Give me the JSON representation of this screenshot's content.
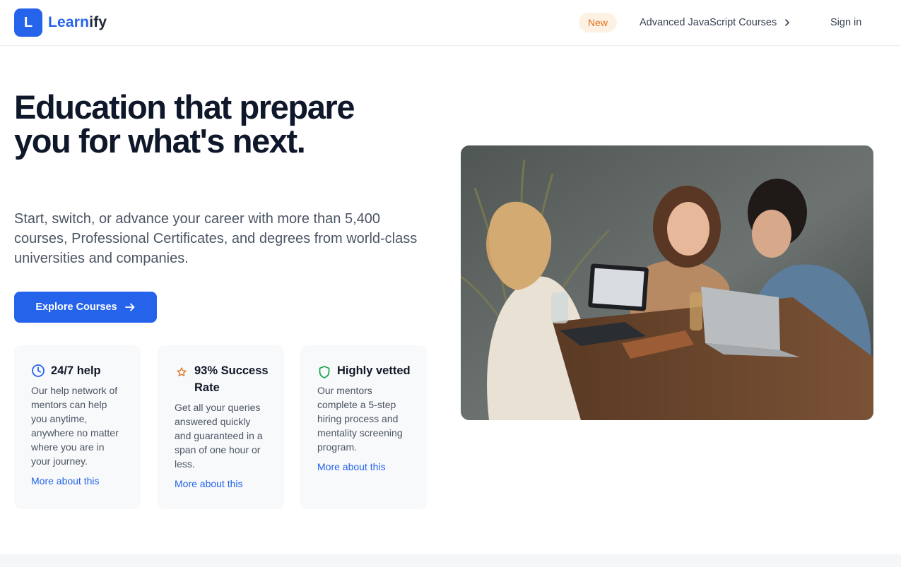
{
  "brand": {
    "logo_letter": "L",
    "name_part1": "Learn",
    "name_part2": "ify",
    "accent_color": "#2563eb"
  },
  "nav": {
    "badge": "New",
    "course_link": "Advanced JavaScript Courses",
    "sign_in": "Sign in"
  },
  "hero": {
    "title": "Education that prepare you for what's next.",
    "subtitle": "Start, switch, or advance your career with more than 5,400 courses, Professional Certificates, and degrees from world-class universities and companies.",
    "cta_label": "Explore Courses"
  },
  "features": [
    {
      "icon": "clock-icon",
      "icon_color": "#2563eb",
      "title": "24/7 help",
      "description": "Our help network of mentors can help you anytime, anywhere no matter where you are in your journey.",
      "link": "More about this"
    },
    {
      "icon": "star-icon",
      "icon_color": "#e0701a",
      "title": "93% Success Rate",
      "description": "Get all your queries answered quickly and guaranteed in a span of one hour or less.",
      "link": "More about this"
    },
    {
      "icon": "shield-icon",
      "icon_color": "#16a34a",
      "title": "Highly vetted",
      "description": "Our mentors complete a 5-step hiring process and mentality screening program.",
      "link": "More about this"
    }
  ]
}
